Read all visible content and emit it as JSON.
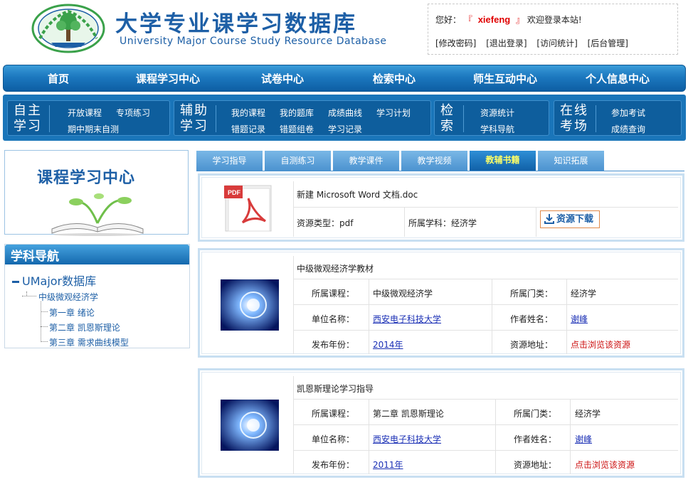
{
  "header": {
    "title": "大学专业课学习数据库",
    "subtitle": "University Major Course Study Resource Database",
    "greeting_prefix": "您好：",
    "open_quote": "『",
    "username": "xiefeng",
    "close_quote": "』",
    "greeting_suffix": "欢迎登录本站!",
    "links": [
      "[修改密码]",
      "[退出登录]",
      "[访问统计]",
      "[后台管理]"
    ]
  },
  "main_nav": [
    "首页",
    "课程学习中心",
    "试卷中心",
    "检索中心",
    "师生互动中心",
    "个人信息中心"
  ],
  "sub_nav": [
    {
      "label": "自主学习",
      "items": [
        "开放课程",
        "专项练习",
        "期中期末自测"
      ]
    },
    {
      "label": "辅助学习",
      "items": [
        "我的课程",
        "我的题库",
        "成绩曲线",
        "学习计划",
        "错题记录",
        "错题组卷",
        "学习记录"
      ]
    },
    {
      "label": "检索",
      "items": [
        "资源统计",
        "学科导航"
      ]
    },
    {
      "label": "在线考场",
      "items": [
        "参加考试",
        "成绩查询"
      ]
    }
  ],
  "sidebar": {
    "banner_title": "课程学习中心",
    "nav_title": "学科导航",
    "tree_root": "UMajor数据库",
    "tree_course": "中级微观经济学",
    "tree_chapters": [
      "第一章  绪论",
      "第二章  凯恩斯理论",
      "第三章  需求曲线模型"
    ]
  },
  "tabs": [
    "学习指导",
    "自测练习",
    "教学课件",
    "教学视频",
    "教辅书籍",
    "知识拓展"
  ],
  "active_tab": "教辅书籍",
  "cards": [
    {
      "title": "新建  Microsoft Word 文档.doc",
      "type_label": "资源类型：",
      "type_value": "pdf",
      "subject_label": "所属学科：",
      "subject_value": "经济学",
      "download_label": "资源下载",
      "thumb_icon": "pdf-icon"
    },
    {
      "title": "中级微观经济学教材",
      "course_label": "所属课程：",
      "course_value": "中级微观经济学",
      "category_label": "所属门类：",
      "category_value": "经济学",
      "org_label": "单位名称：",
      "org_value": "西安电子科技大学",
      "author_label": "作者姓名：",
      "author_value": "谢峰",
      "year_label": "发布年份：",
      "year_value": "2014年",
      "address_label": "资源地址：",
      "address_value": "点击浏览该资源"
    },
    {
      "title": "凯恩斯理论学习指导",
      "course_label": "所属课程：",
      "course_value": "第二章  凯恩斯理论",
      "category_label": "所属门类：",
      "category_value": "经济学",
      "org_label": "单位名称：",
      "org_value": "西安电子科技大学",
      "author_label": "作者姓名：",
      "author_value": "谢峰",
      "year_label": "发布年份：",
      "year_value": "2011年",
      "address_label": "资源地址：",
      "address_value": "点击浏览该资源"
    }
  ],
  "colors": {
    "brand_blue": "#1d5fa6",
    "nav_blue": "#1a75b9",
    "link": "#1a2fb5",
    "alert_red": "#cc1111",
    "active_tab_text": "#ffff66"
  }
}
